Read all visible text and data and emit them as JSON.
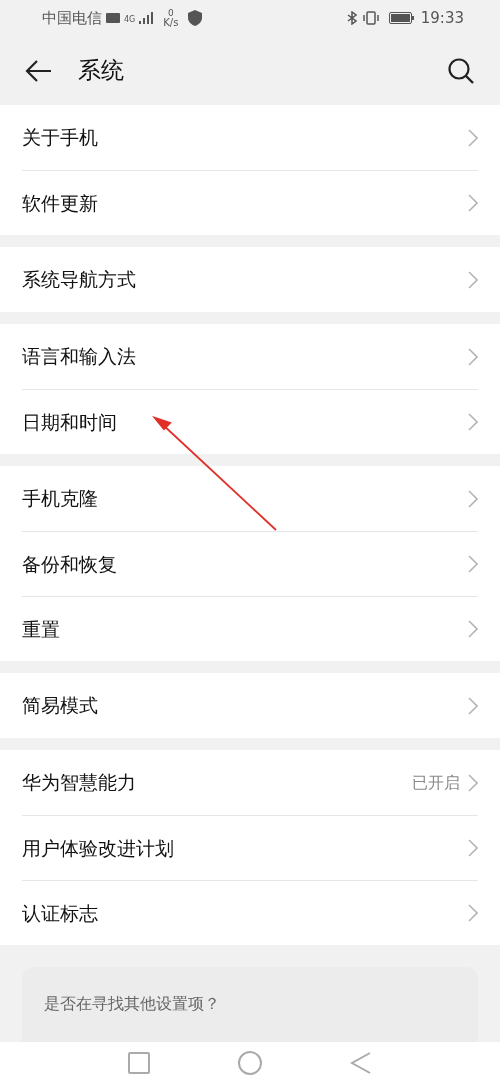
{
  "status_bar": {
    "carrier": "中国电信",
    "network": "4G",
    "speed_value": "0",
    "speed_unit": "K/s",
    "time": "19:33"
  },
  "header": {
    "title": "系统"
  },
  "groups": [
    {
      "items": [
        {
          "label": "关于手机"
        },
        {
          "label": "软件更新"
        }
      ]
    },
    {
      "items": [
        {
          "label": "系统导航方式"
        }
      ]
    },
    {
      "items": [
        {
          "label": "语言和输入法"
        },
        {
          "label": "日期和时间"
        }
      ]
    },
    {
      "items": [
        {
          "label": "手机克隆"
        },
        {
          "label": "备份和恢复"
        },
        {
          "label": "重置"
        }
      ]
    },
    {
      "items": [
        {
          "label": "简易模式"
        }
      ]
    },
    {
      "items": [
        {
          "label": "华为智慧能力",
          "value": "已开启"
        },
        {
          "label": "用户体验改进计划"
        },
        {
          "label": "认证标志"
        }
      ]
    }
  ],
  "suggestion_card": {
    "text": "是否在寻找其他设置项？"
  }
}
